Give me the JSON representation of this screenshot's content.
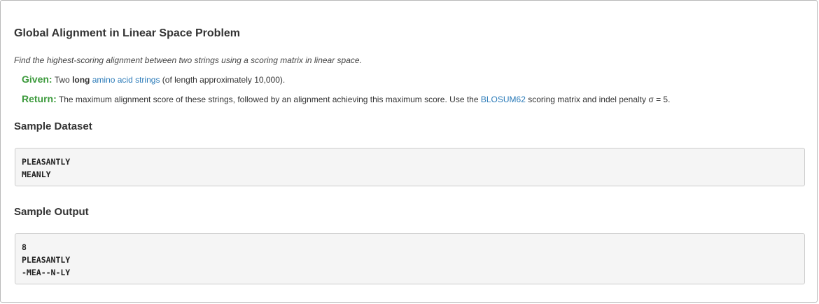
{
  "problem": {
    "title": "Global Alignment in Linear Space Problem",
    "intro": "Find the highest-scoring alignment between two strings using a scoring matrix in linear space.",
    "given": {
      "label": "Given:",
      "text_before": "Two",
      "bold_word": "long",
      "link_text": "amino acid strings",
      "text_after": "(of length approximately 10,000)."
    },
    "return": {
      "label": "Return:",
      "text_before": "The maximum alignment score of these strings, followed by an alignment achieving this maximum score. Use the",
      "link_text": "BLOSUM62",
      "text_after": "scoring matrix and indel penalty σ = 5."
    }
  },
  "sample_dataset": {
    "heading": "Sample Dataset",
    "lines": [
      "PLEASANTLY",
      "MEANLY"
    ]
  },
  "sample_output": {
    "heading": "Sample Output",
    "lines": [
      "8",
      "PLEASANTLY",
      "-MEA--N-LY"
    ]
  },
  "colors": {
    "keyword": "#3c9a3c",
    "link": "#2a7ab8",
    "code_background": "#f5f5f5"
  }
}
